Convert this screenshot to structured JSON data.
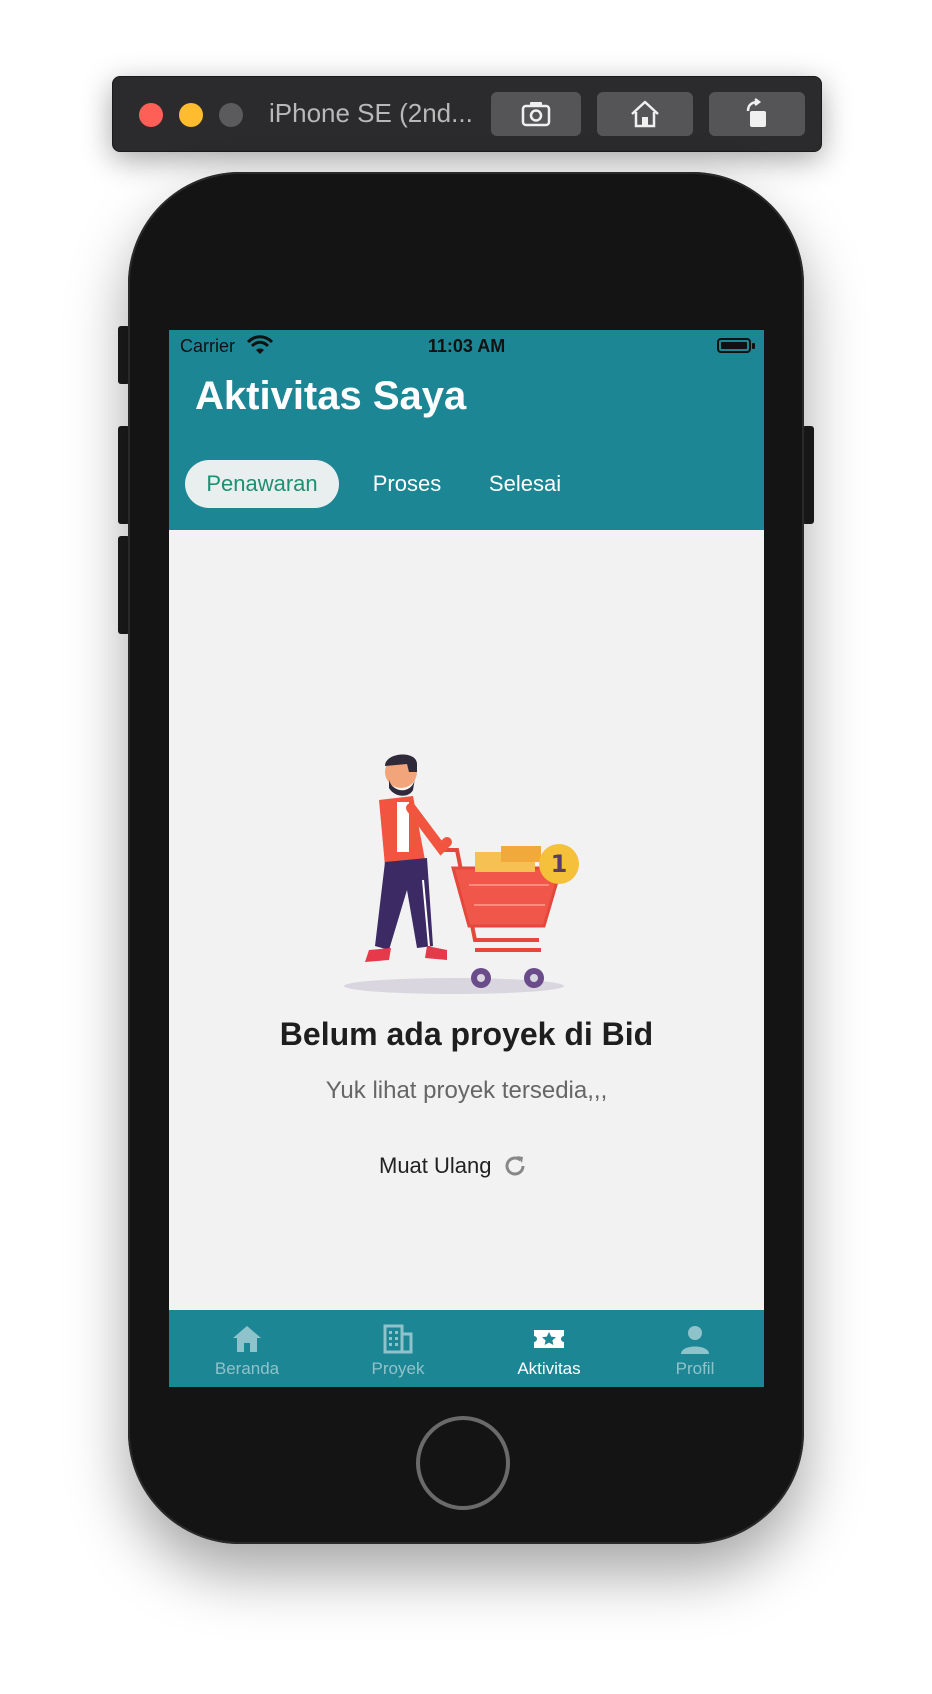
{
  "simulator": {
    "title": "iPhone SE (2nd...",
    "buttons": [
      "screenshot-icon",
      "home-icon",
      "rotate-icon"
    ]
  },
  "status_bar": {
    "carrier": "Carrier",
    "time": "11:03 AM"
  },
  "header": {
    "title": "Aktivitas Saya"
  },
  "tabs": [
    {
      "label": "Penawaran",
      "active": true
    },
    {
      "label": "Proses",
      "active": false
    },
    {
      "label": "Selesai",
      "active": false
    }
  ],
  "empty_state": {
    "title": "Belum ada proyek di Bid",
    "subtitle": "Yuk lihat proyek tersedia,,,",
    "reload_label": "Muat Ulang",
    "badge_number": "1"
  },
  "bottom_nav": [
    {
      "label": "Beranda",
      "icon": "home-icon",
      "active": false
    },
    {
      "label": "Proyek",
      "icon": "building-icon",
      "active": false
    },
    {
      "label": "Aktivitas",
      "icon": "ticket-star-icon",
      "active": true
    },
    {
      "label": "Profil",
      "icon": "person-icon",
      "active": false
    }
  ],
  "colors": {
    "primary": "#1d8694",
    "active_tab_text": "#1d8f72",
    "background": "#f2f2f2"
  }
}
